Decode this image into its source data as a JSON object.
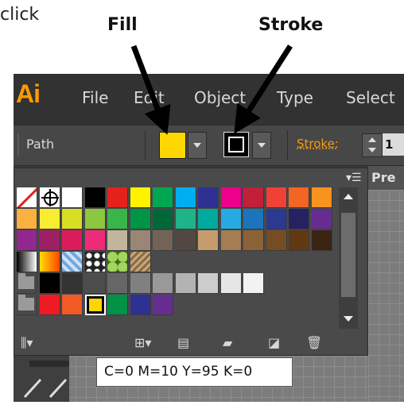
{
  "intro": {
    "text": "click"
  },
  "annotations": {
    "fill": "Fill",
    "stroke": "Stroke"
  },
  "app": {
    "logo": "Ai",
    "menu": [
      "File",
      "Edit",
      "Object",
      "Type",
      "Select"
    ]
  },
  "control_bar": {
    "selection_label": "Path",
    "fill_color": "#fed700",
    "stroke_label": "Stroke:",
    "stroke_value": "1"
  },
  "panel": {
    "side_tab": "Pre",
    "swatch_rows": [
      [
        "none",
        "registration",
        "#ffffff",
        "#000000",
        "#e5211d",
        "#fef200",
        "#00a650",
        "#00adef",
        "#2e3192",
        "#ec008c",
        "#c21f39",
        "#ef4136",
        "#f26522",
        "#f7941d"
      ],
      [
        "#fbb040",
        "#f9ed32",
        "#d7df23",
        "#8dc63f",
        "#39b54a",
        "#009444",
        "#006838",
        "#1fb389",
        "#00a99d",
        "#27aae1",
        "#1c75bc",
        "#2b3990",
        "#262262",
        "#662d91"
      ],
      [
        "#92278f",
        "#9e1f63",
        "#da1c5c",
        "#ee2a7b",
        "#c2b59b",
        "#998675",
        "#736357",
        "#534741",
        "#c69c6d",
        "#a67c52",
        "#8c6239",
        "#754c24",
        "#603913",
        "#3c2415"
      ],
      [
        "gradient-gray",
        "gradient-orange",
        "pattern-blue",
        "pattern-dots",
        "pattern-green",
        "pattern-brown"
      ],
      [
        "folder",
        "#000000",
        "#333333",
        "#4d4d4d",
        "#666666",
        "#808080",
        "#999999",
        "#b3b3b3",
        "#cccccc",
        "#e6e6e6",
        "#f2f2f2"
      ],
      [
        "folder",
        "#ed1c24",
        "#f15a24",
        "selected:#fed700",
        "#009245",
        "#2e3192",
        "#662d91"
      ]
    ],
    "footer_icons": [
      "swatch-libraries-icon",
      "show-kinds-icon",
      "swatch-options-icon",
      "new-color-group-icon",
      "new-swatch-icon",
      "delete-swatch-icon"
    ]
  },
  "tooltip": {
    "text": "C=0 M=10 Y=95 K=0"
  }
}
